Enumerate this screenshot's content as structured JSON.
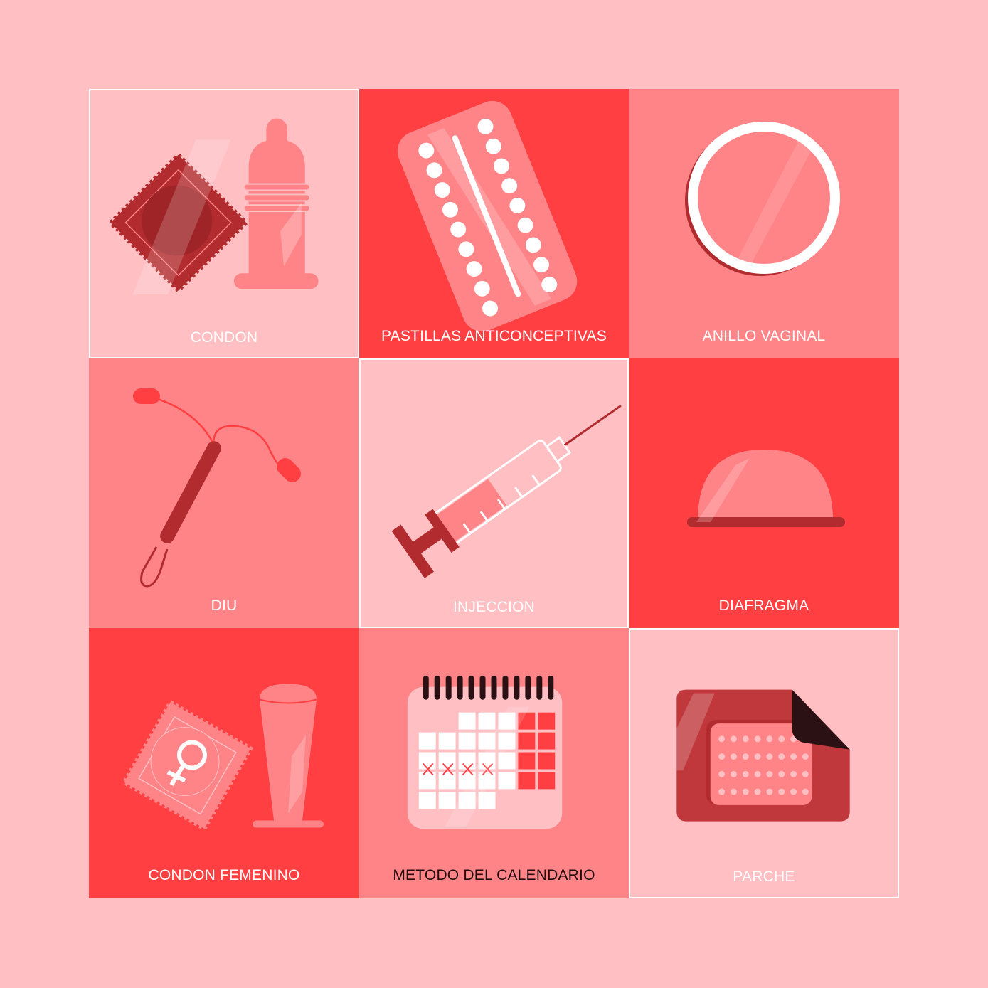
{
  "colors": {
    "page_bg": "#ffbfc3",
    "light": "#ffbfc3",
    "mid": "#ff8488",
    "bright": "#ff3f42",
    "dark": "#b22b2e",
    "white": "#ffffff",
    "black": "#2b1114"
  },
  "tiles": [
    {
      "label": "CONDON",
      "icon": "condom-icon",
      "bg": "#ffbfc3",
      "label_color": "#ffffff",
      "outlined": true
    },
    {
      "label": "PASTILLAS ANTICONCEPTIVAS",
      "icon": "pill-pack-icon",
      "bg": "#ff3f42",
      "label_color": "#ffffff",
      "outlined": false
    },
    {
      "label": "ANILLO VAGINAL",
      "icon": "vaginal-ring-icon",
      "bg": "#ff8488",
      "label_color": "#ffffff",
      "outlined": false
    },
    {
      "label": "DIU",
      "icon": "iud-icon",
      "bg": "#ff8488",
      "label_color": "#ffffff",
      "outlined": false
    },
    {
      "label": "INJECCION",
      "icon": "syringe-icon",
      "bg": "#ffbfc3",
      "label_color": "#ffffff",
      "outlined": true
    },
    {
      "label": "DIAFRAGMA",
      "icon": "diaphragm-icon",
      "bg": "#ff3f42",
      "label_color": "#ffffff",
      "outlined": false
    },
    {
      "label": "CONDON FEMENINO",
      "icon": "female-condom-icon",
      "bg": "#ff3f42",
      "label_color": "#ffffff",
      "outlined": false
    },
    {
      "label": "METODO DEL CALENDARIO",
      "icon": "calendar-icon",
      "bg": "#ff8488",
      "label_color": "#1f0a0b",
      "outlined": false
    },
    {
      "label": "PARCHE",
      "icon": "patch-icon",
      "bg": "#ffbfc3",
      "label_color": "#ffffff",
      "outlined": true
    }
  ]
}
